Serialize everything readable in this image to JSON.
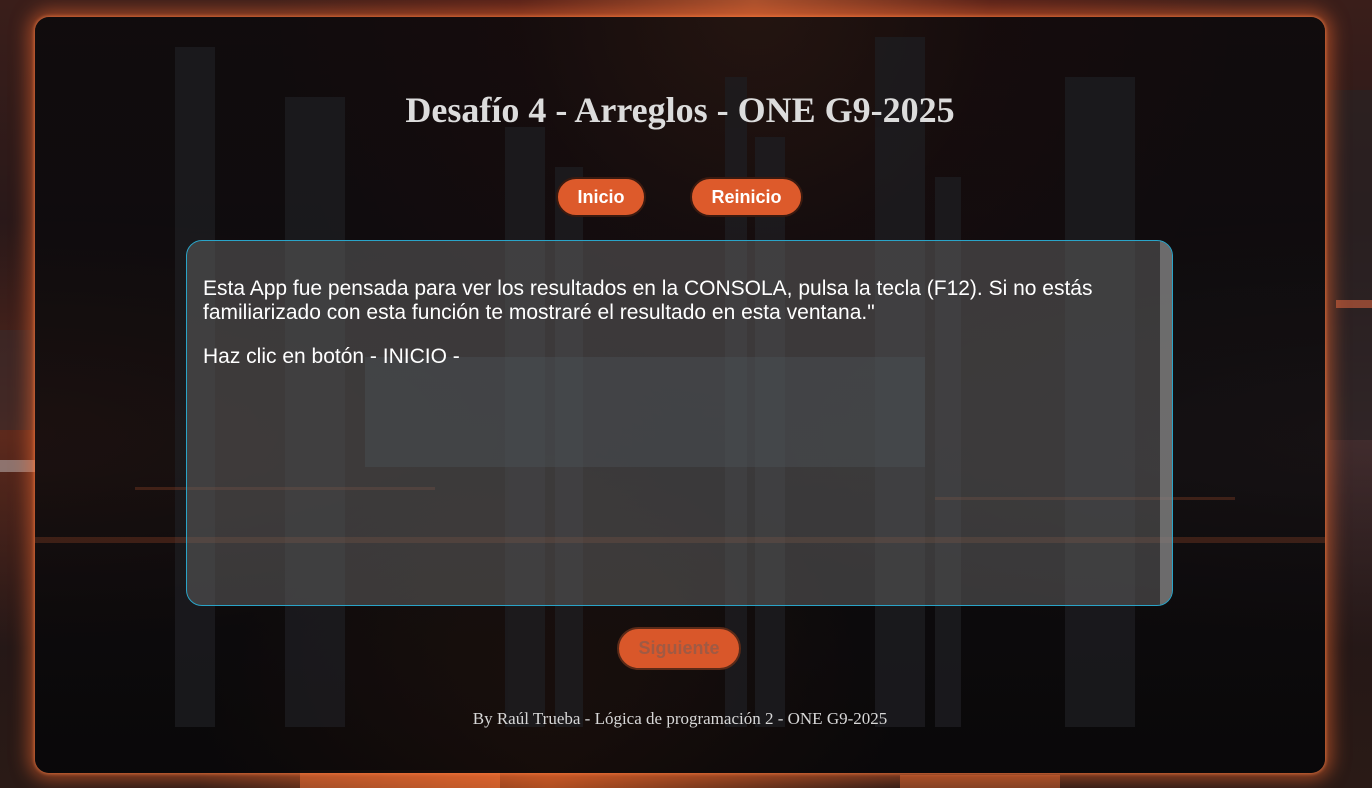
{
  "colors": {
    "accent": "#dd5a2b",
    "box_border": "#2aa4c8",
    "glow": "#ff6e32"
  },
  "header": {
    "title": "Desafío 4 - Arreglos - ONE G9-2025"
  },
  "controls": {
    "start_label": "Inicio",
    "reset_label": "Reinicio",
    "next_label": "Siguiente",
    "next_disabled": true
  },
  "output": {
    "line1": "Esta App fue pensada para ver los resultados en la CONSOLA, pulsa la tecla (F12). Si no estás familiarizado con esta función te mostraré el resultado en esta ventana.\"",
    "line2": "Haz clic en botón - INICIO -"
  },
  "footer": {
    "credit": "By Raúl Trueba - Lógica de programación 2 - ONE G9-2025"
  },
  "icons": [
    "background-city-image"
  ]
}
